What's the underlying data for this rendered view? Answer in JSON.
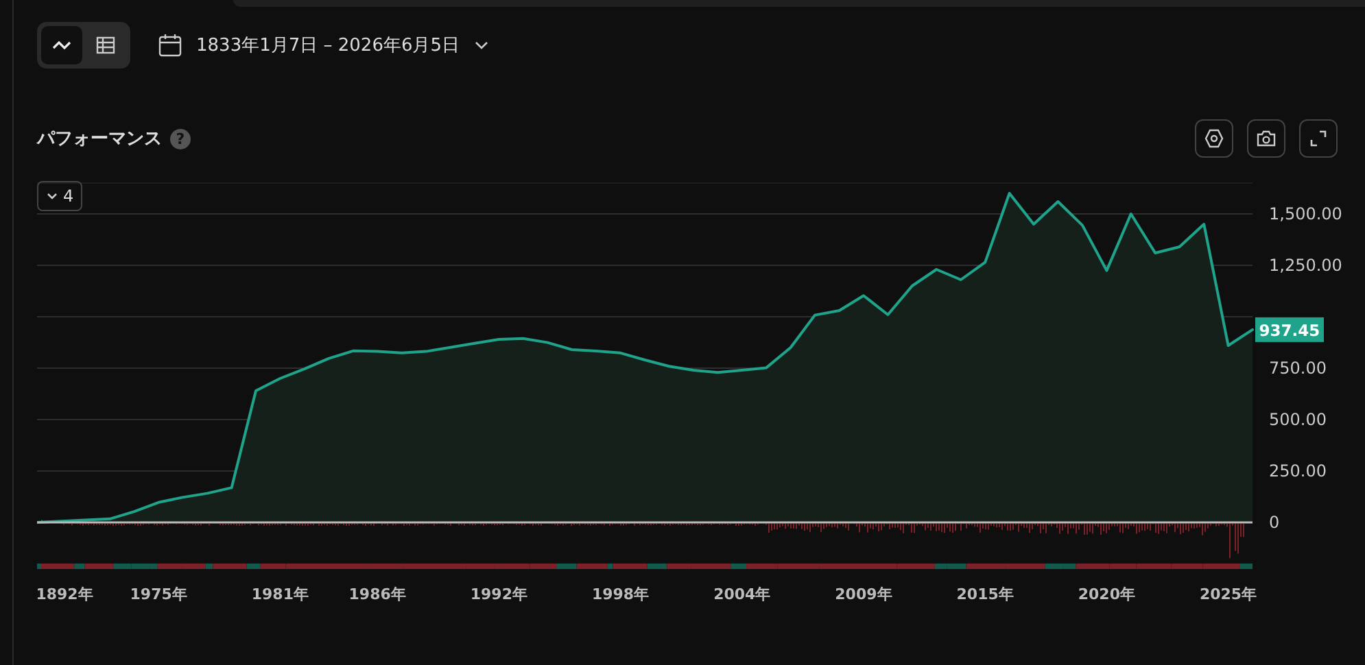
{
  "toolbar": {
    "view_toggles": [
      {
        "kind": "line",
        "selected": true
      },
      {
        "kind": "table",
        "selected": false
      }
    ],
    "date_range": "1833年1月7日 – 2026年6月5日"
  },
  "performance": {
    "title": "パフォーマンス",
    "help": "?",
    "series_count": "4",
    "price_tag": "937.45",
    "chart_data": {
      "type": "line",
      "grid": true,
      "ylim": [
        0,
        1650
      ],
      "categories": [
        null,
        "1892年",
        null,
        null,
        null,
        "1975年",
        null,
        null,
        null,
        null,
        "1981年",
        null,
        null,
        null,
        "1986年",
        null,
        null,
        null,
        null,
        "1992年",
        null,
        null,
        null,
        null,
        "1998年",
        null,
        null,
        null,
        null,
        "2004年",
        null,
        null,
        null,
        null,
        "2009年",
        null,
        null,
        null,
        null,
        "2015年",
        null,
        null,
        null,
        null,
        "2020年",
        null,
        null,
        null,
        null,
        "2025年",
        null
      ],
      "yticks": [
        {
          "value": 0,
          "label": "0"
        },
        {
          "value": 250,
          "label": "250.00"
        },
        {
          "value": 500,
          "label": "500.00"
        },
        {
          "value": 750,
          "label": "750.00"
        },
        {
          "value": 1250,
          "label": "1,250.00"
        },
        {
          "value": 1500,
          "label": "1,500.00"
        }
      ],
      "series": [
        {
          "color": "#1fa38a",
          "values": [
            0,
            6,
            11,
            17,
            53,
            97,
            122,
            141,
            169,
            640,
            700,
            746,
            797,
            834,
            832,
            824,
            831,
            851,
            871,
            890,
            894,
            875,
            840,
            833,
            824,
            790,
            759,
            740,
            729,
            740,
            752,
            850,
            1008,
            1030,
            1103,
            1010,
            1150,
            1230,
            1180,
            1265,
            1600,
            1450,
            1560,
            1445,
            1225,
            1500,
            1310,
            1340,
            1450,
            860,
            937
          ]
        }
      ]
    }
  }
}
